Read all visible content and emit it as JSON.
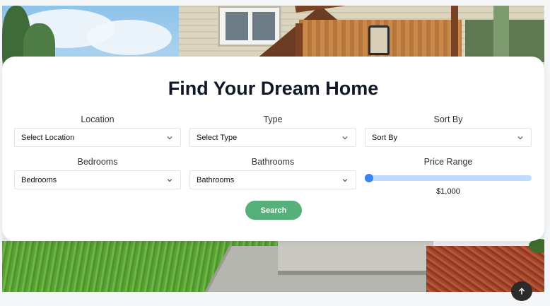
{
  "page": {
    "title": "Find Your Dream Home"
  },
  "filters": {
    "location": {
      "label": "Location",
      "value": "Select Location"
    },
    "type": {
      "label": "Type",
      "value": "Select Type"
    },
    "sort": {
      "label": "Sort By",
      "value": "Sort By"
    },
    "bedrooms": {
      "label": "Bedrooms",
      "value": "Bedrooms"
    },
    "bathrooms": {
      "label": "Bathrooms",
      "value": "Bathrooms"
    },
    "price": {
      "label": "Price Range",
      "value_text": "$1,000",
      "fraction": 0.0
    }
  },
  "actions": {
    "search_label": "Search"
  },
  "icons": {
    "dropdown": "chevron-down-icon",
    "scroll_top": "arrow-up-icon"
  },
  "colors": {
    "accent_blue": "#3b82f6",
    "track_blue": "#bfdbfe",
    "search_green": "#55b07a",
    "title": "#111827"
  }
}
